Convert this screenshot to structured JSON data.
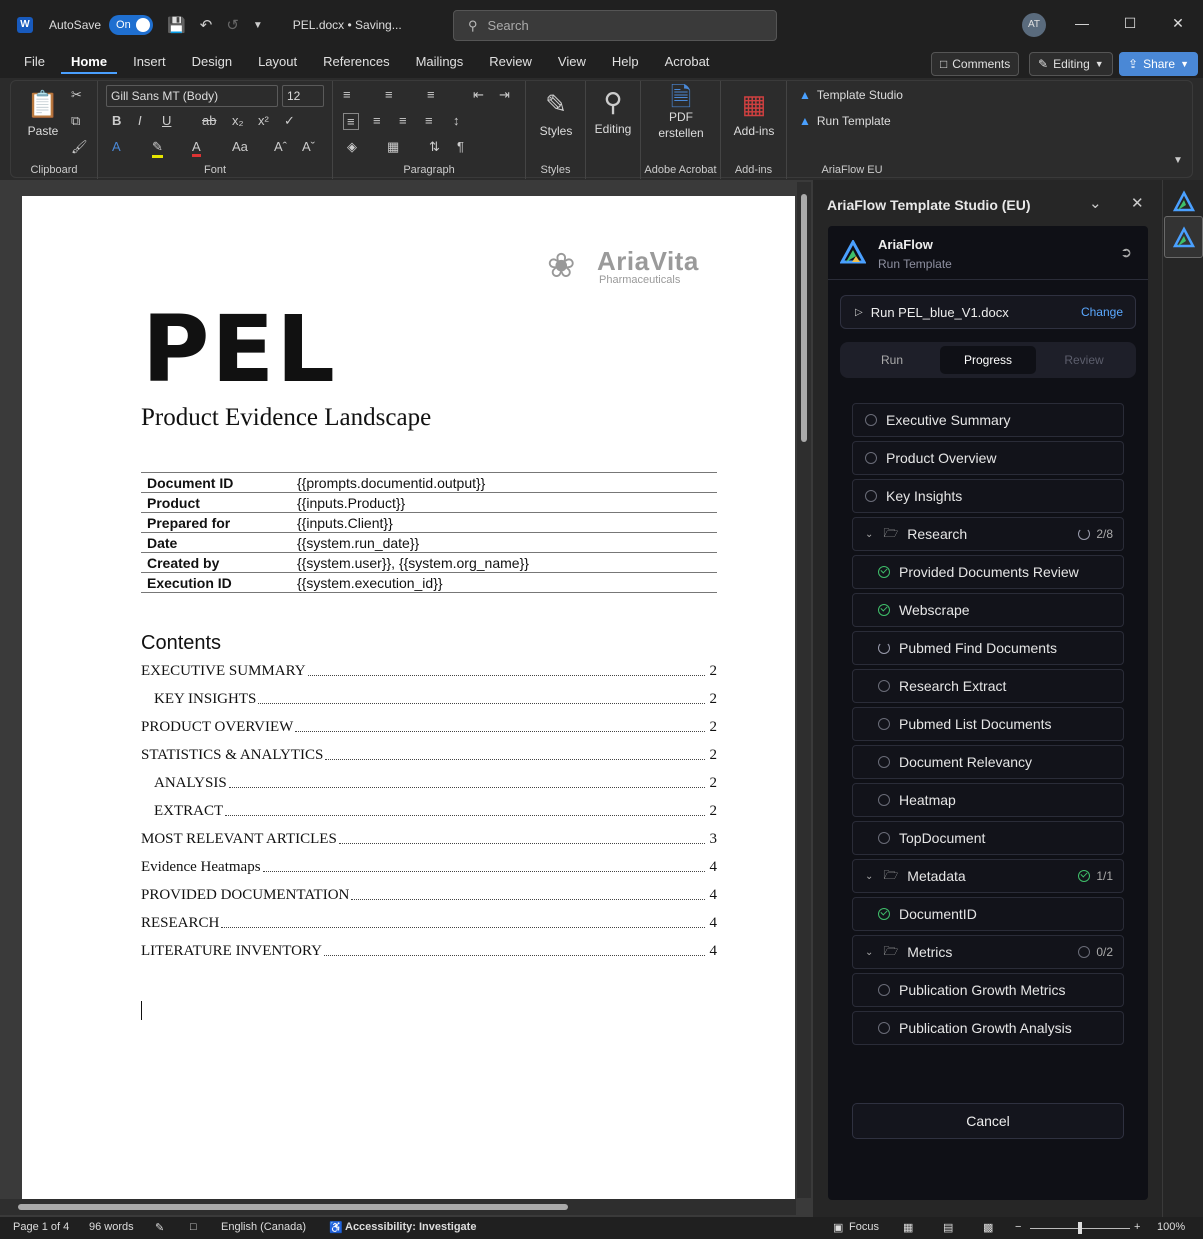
{
  "titlebar": {
    "app_icon": "W",
    "autosave_label": "AutoSave",
    "autosave_state": "On",
    "doc_title": "PEL.docx • Saving...",
    "search_placeholder": "Search",
    "avatar_initials": "AT"
  },
  "menu": {
    "tabs": [
      "File",
      "Home",
      "Insert",
      "Design",
      "Layout",
      "References",
      "Mailings",
      "Review",
      "View",
      "Help",
      "Acrobat"
    ],
    "active": "Home",
    "comments": "Comments",
    "editing": "Editing",
    "share": "Share"
  },
  "ribbon": {
    "paste": "Paste",
    "clipboard": "Clipboard",
    "font_name": "Gill Sans MT (Body)",
    "font_size": "12",
    "font": "Font",
    "paragraph": "Paragraph",
    "styles_btn": "Styles",
    "styles": "Styles",
    "editing_btn": "Editing",
    "pdf_line1": "PDF",
    "pdf_line2": "erstellen",
    "adobe": "Adobe Acrobat",
    "addins_btn": "Add-ins",
    "addins": "Add-ins",
    "template_studio": "Template Studio",
    "run_template": "Run Template",
    "ariaflow_eu": "AriaFlow EU"
  },
  "document": {
    "logo_name": "AriaVita",
    "logo_sub": "Pharmaceuticals",
    "title": "PEL",
    "subtitle": "Product Evidence Landscape",
    "meta": [
      {
        "k": "Document ID",
        "v": "{{prompts.documentid.output}}"
      },
      {
        "k": "Product",
        "v": "{{inputs.Product}}"
      },
      {
        "k": "Prepared for",
        "v": "{{inputs.Client}}"
      },
      {
        "k": "Date",
        "v": "{{system.run_date}}"
      },
      {
        "k": "Created by",
        "v": "{{system.user}}, {{system.org_name}}"
      },
      {
        "k": "Execution ID",
        "v": "{{system.execution_id}}"
      }
    ],
    "contents_heading": "Contents",
    "toc": [
      {
        "label": "EXECUTIVE SUMMARY",
        "page": "2",
        "indent": false
      },
      {
        "label": "KEY INSIGHTS",
        "page": "2",
        "indent": true
      },
      {
        "label": "PRODUCT OVERVIEW",
        "page": "2",
        "indent": false
      },
      {
        "label": "STATISTICS & ANALYTICS",
        "page": "2",
        "indent": false
      },
      {
        "label": "ANALYSIS",
        "page": "2",
        "indent": true
      },
      {
        "label": "EXTRACT",
        "page": "2",
        "indent": true
      },
      {
        "label": "MOST RELEVANT ARTICLES",
        "page": "3",
        "indent": false
      },
      {
        "label": "Evidence Heatmaps",
        "page": "4",
        "indent": false
      },
      {
        "label": "PROVIDED DOCUMENTATION",
        "page": "4",
        "indent": false
      },
      {
        "label": "RESEARCH",
        "page": "4",
        "indent": false
      },
      {
        "label": "LITERATURE INVENTORY",
        "page": "4",
        "indent": false
      }
    ]
  },
  "panel": {
    "title": "AriaFlow Template Studio (EU)",
    "app_name": "AriaFlow",
    "app_sub": "Run Template",
    "run_file": "Run PEL_blue_V1.docx",
    "change": "Change",
    "tabs": [
      "Run",
      "Progress",
      "Review"
    ],
    "steps": [
      {
        "label": "Executive Summary",
        "state": "pending",
        "kind": "item"
      },
      {
        "label": "Product Overview",
        "state": "pending",
        "kind": "item"
      },
      {
        "label": "Key Insights",
        "state": "pending",
        "kind": "item"
      },
      {
        "label": "Research",
        "state": "running",
        "kind": "group",
        "count": "2/8"
      },
      {
        "label": "Provided Documents Review",
        "state": "done",
        "kind": "sub"
      },
      {
        "label": "Webscrape",
        "state": "done",
        "kind": "sub"
      },
      {
        "label": "Pubmed Find Documents",
        "state": "running",
        "kind": "sub"
      },
      {
        "label": "Research Extract",
        "state": "pending",
        "kind": "sub"
      },
      {
        "label": "Pubmed List Documents",
        "state": "pending",
        "kind": "sub"
      },
      {
        "label": "Document Relevancy",
        "state": "pending",
        "kind": "sub"
      },
      {
        "label": "Heatmap",
        "state": "pending",
        "kind": "sub"
      },
      {
        "label": "TopDocument",
        "state": "pending",
        "kind": "sub"
      },
      {
        "label": "Metadata",
        "state": "done",
        "kind": "group",
        "count": "1/1"
      },
      {
        "label": "DocumentID",
        "state": "done",
        "kind": "sub"
      },
      {
        "label": "Metrics",
        "state": "pending",
        "kind": "group",
        "count": "0/2"
      },
      {
        "label": "Publication Growth Metrics",
        "state": "pending",
        "kind": "sub"
      },
      {
        "label": "Publication Growth Analysis",
        "state": "pending",
        "kind": "sub"
      }
    ],
    "cancel": "Cancel"
  },
  "status": {
    "page": "Page 1 of 4",
    "words": "96 words",
    "language": "English (Canada)",
    "accessibility": "Accessibility: Investigate",
    "focus": "Focus",
    "zoom": "100%",
    "zoom_level": 0.5
  },
  "colors": {
    "accent": "#4aa0ff",
    "word_blue": "#185abd",
    "done_green": "#3fbf6a"
  }
}
